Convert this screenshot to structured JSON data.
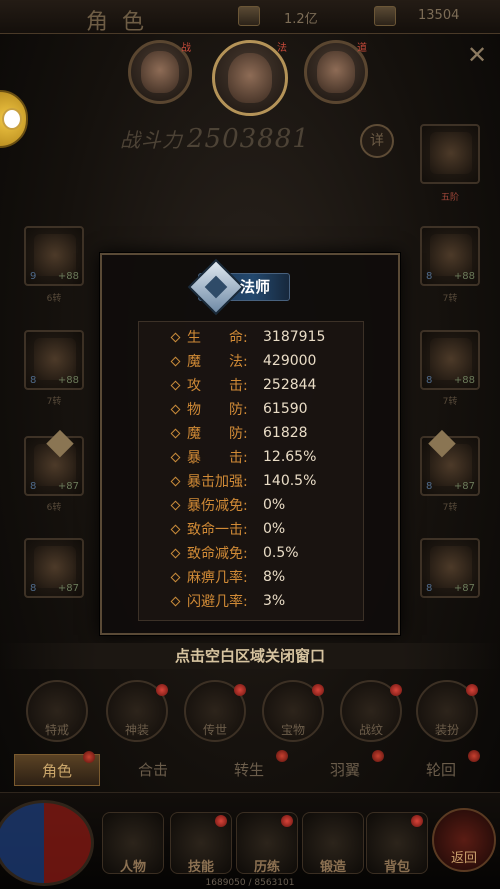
{
  "topbar": {
    "title": "角色",
    "gold": "1.2亿",
    "ingot": "13504"
  },
  "characters": [
    {
      "tag": "战"
    },
    {
      "tag": "法"
    },
    {
      "tag": "道"
    }
  ],
  "power": {
    "label": "战斗力",
    "value": "2503881",
    "detail_label": "详"
  },
  "slots": {
    "weapon": {
      "level": "9",
      "plus": "+88",
      "caption": "6转"
    },
    "helmet": {
      "level": "8",
      "plus": "+88",
      "caption": "7转"
    },
    "armor": {
      "level": "8",
      "plus": "+88",
      "caption": "7转"
    },
    "necklace": {
      "level": "8",
      "plus": "+88",
      "caption": "7转"
    },
    "bracelet_l": {
      "level": "8",
      "plus": "+87",
      "caption": "6转"
    },
    "bracelet_r": {
      "level": "8",
      "plus": "+87",
      "caption": "7转"
    },
    "ring_l": {
      "level": "8",
      "plus": "+87",
      "caption": ""
    },
    "ring_r": {
      "level": "8",
      "plus": "+87",
      "caption": ""
    },
    "medal": {
      "caption": "五阶"
    }
  },
  "stats_popup": {
    "class_name": "法师",
    "stats": [
      {
        "key": "生　　命:",
        "value": "3187915"
      },
      {
        "key": "魔　　法:",
        "value": "429000"
      },
      {
        "key": "攻　　击:",
        "value": "252844"
      },
      {
        "key": "物　　防:",
        "value": "61590"
      },
      {
        "key": "魔　　防:",
        "value": "61828"
      },
      {
        "key": "暴　　击:",
        "value": "12.65%"
      },
      {
        "key": "暴击加强:",
        "value": "140.5%"
      },
      {
        "key": "暴伤减免:",
        "value": "0%"
      },
      {
        "key": "致命一击:",
        "value": "0%"
      },
      {
        "key": "致命减免:",
        "value": "0.5%"
      },
      {
        "key": "麻痹几率:",
        "value": "8%"
      },
      {
        "key": "闪避几率:",
        "value": "3%"
      }
    ]
  },
  "close_hint": "点击空白区域关闭窗口",
  "functions": [
    "特戒",
    "神装",
    "传世",
    "宝物",
    "战纹",
    "装扮"
  ],
  "tabs": [
    "角色",
    "合击",
    "转生",
    "羽翼",
    "轮回"
  ],
  "nav": [
    "人物",
    "技能",
    "历练",
    "锻造",
    "背包"
  ],
  "back_label": "返回",
  "exp_text": "1689050 / 8563101"
}
